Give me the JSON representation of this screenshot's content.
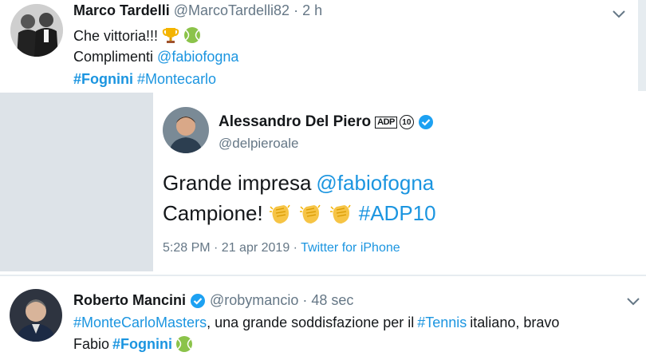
{
  "tweet1": {
    "name": "Marco Tardelli",
    "handle": "@MarcoTardelli82",
    "sep": "·",
    "time": "2 h",
    "line1_text": "Che vittoria!!!",
    "line2_text": "Complimenti",
    "line2_mention": "@fabiofogna",
    "hashtag1": "#Fognini",
    "hashtag2": "#Montecarlo"
  },
  "quoted": {
    "name": "Alessandro Del Piero",
    "badge_text": "ADP",
    "badge_num": "10",
    "handle": "@delpieroale",
    "line1_text": "Grande impresa",
    "line1_mention": "@fabiofogna",
    "line2_text": "Campione!",
    "line2_hashtag": "#ADP10",
    "time": "5:28 PM · 21 apr 2019 ·",
    "source": "Twitter for iPhone"
  },
  "tweet3": {
    "name": "Roberto Mancini",
    "handle": "@robymancio",
    "sep": "·",
    "time": "48 sec",
    "line1_hashtag": "#MonteCarloMasters",
    "line1_text": ", una grande soddisfazione per il",
    "line1_hashtag2": "#Tennis",
    "line1_text2": "italiano, bravo",
    "line2_text": "Fabio",
    "line2_hashtag": "#Fognini"
  },
  "colors": {
    "link": "#1b95e0",
    "text": "#14171a",
    "muted": "#657786",
    "verified": "#1da1f2"
  },
  "icons": {
    "trophy": "trophy-icon",
    "ball": "tennis-ball-icon",
    "clap": "clapping-hands-icon",
    "verified": "verified-badge-icon",
    "chevron": "chevron-down-icon"
  }
}
